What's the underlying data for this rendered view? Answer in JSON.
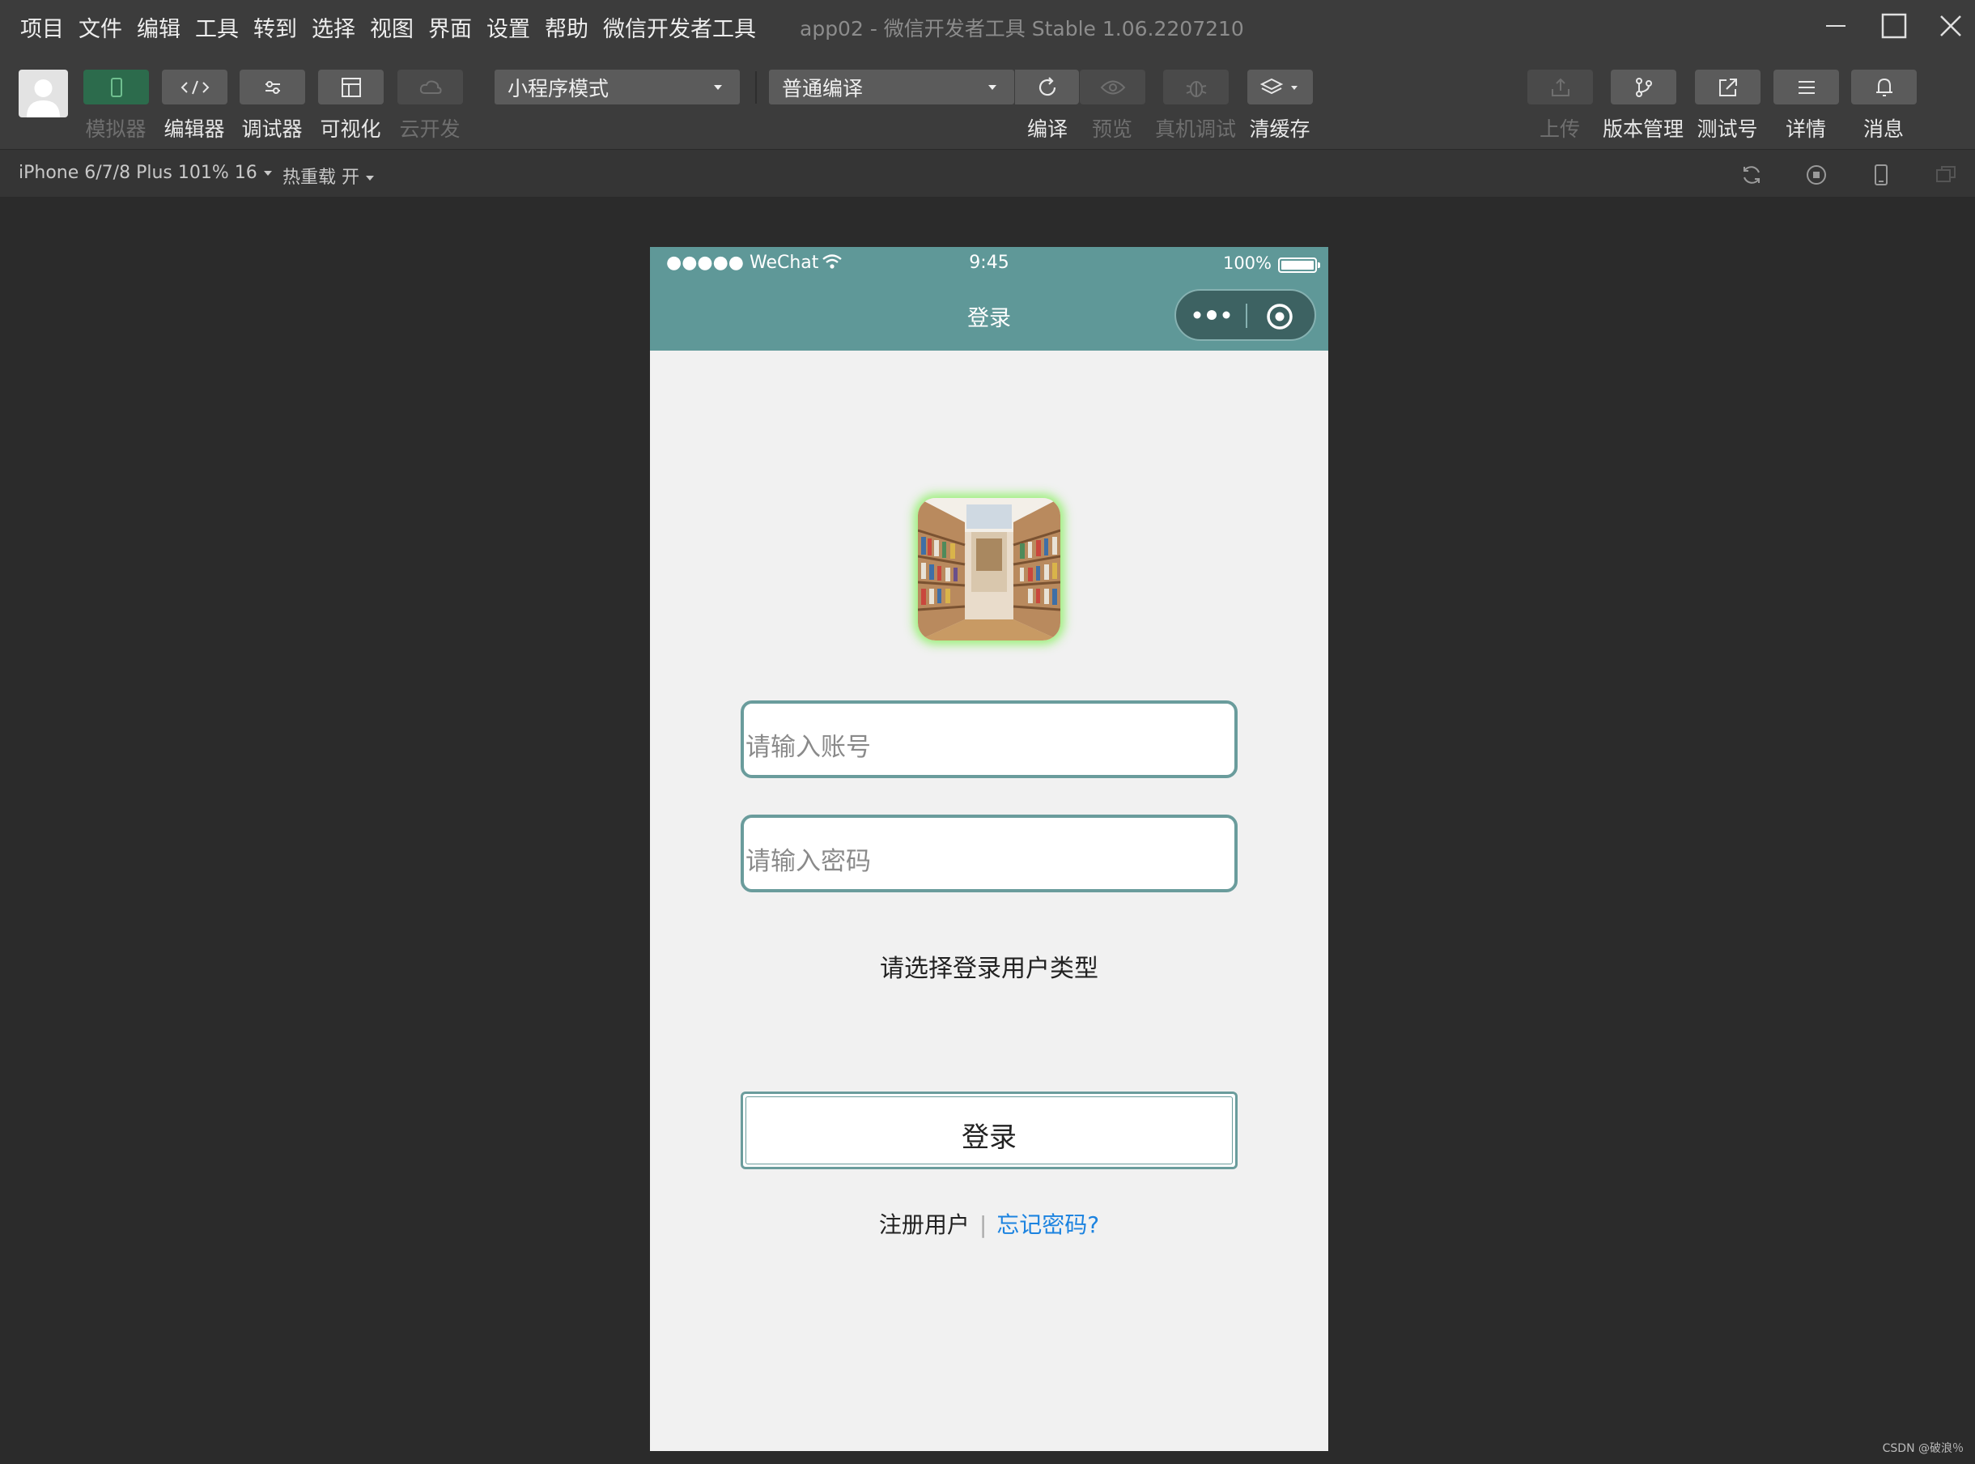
{
  "menubar": {
    "items": [
      "项目",
      "文件",
      "编辑",
      "工具",
      "转到",
      "选择",
      "视图",
      "界面",
      "设置",
      "帮助",
      "微信开发者工具"
    ],
    "window_title": "app02 - 微信开发者工具 Stable 1.06.2207210"
  },
  "toolbar": {
    "left_buttons": [
      {
        "label": "模拟器",
        "icon": "phone-icon",
        "active": true
      },
      {
        "label": "编辑器",
        "icon": "code-icon"
      },
      {
        "label": "调试器",
        "icon": "debugger-icon"
      },
      {
        "label": "可视化",
        "icon": "layout-icon"
      },
      {
        "label": "云开发",
        "icon": "cloud-icon",
        "disabled": true
      }
    ],
    "mode_select": "小程序模式",
    "compile_select": "普通编译",
    "action_buttons": [
      {
        "label": "编译",
        "icon": "refresh-icon"
      },
      {
        "label": "预览",
        "icon": "eye-icon",
        "disabled": true
      },
      {
        "label": "真机调试",
        "icon": "bug-icon",
        "disabled": true
      },
      {
        "label": "清缓存",
        "icon": "layers-icon"
      }
    ],
    "right_buttons": [
      {
        "label": "上传",
        "icon": "upload-icon",
        "disabled": true
      },
      {
        "label": "版本管理",
        "icon": "branch-icon"
      },
      {
        "label": "测试号",
        "icon": "external-link-icon"
      },
      {
        "label": "详情",
        "icon": "menu-icon"
      },
      {
        "label": "消息",
        "icon": "bell-icon"
      }
    ]
  },
  "subbar": {
    "device": "iPhone 6/7/8 Plus 101% 16",
    "hot_reload": "热重载 开"
  },
  "phone": {
    "status": {
      "carrier": "●●●●● WeChat",
      "time": "9:45",
      "battery": "100%"
    },
    "nav_title": "登录",
    "account_placeholder": "请输入账号",
    "password_placeholder": "请输入密码",
    "select_type_text": "请选择登录用户类型",
    "login_button": "登录",
    "register_link": "注册用户",
    "link_separator": "|",
    "forgot_link": "忘记密码?"
  },
  "watermark": "CSDN @破浪％",
  "colors": {
    "nav_teal": "#5f9898",
    "field_border": "#6a9c9c",
    "forgot_blue": "#1c83e0",
    "active_green": "#2c6b4c"
  }
}
